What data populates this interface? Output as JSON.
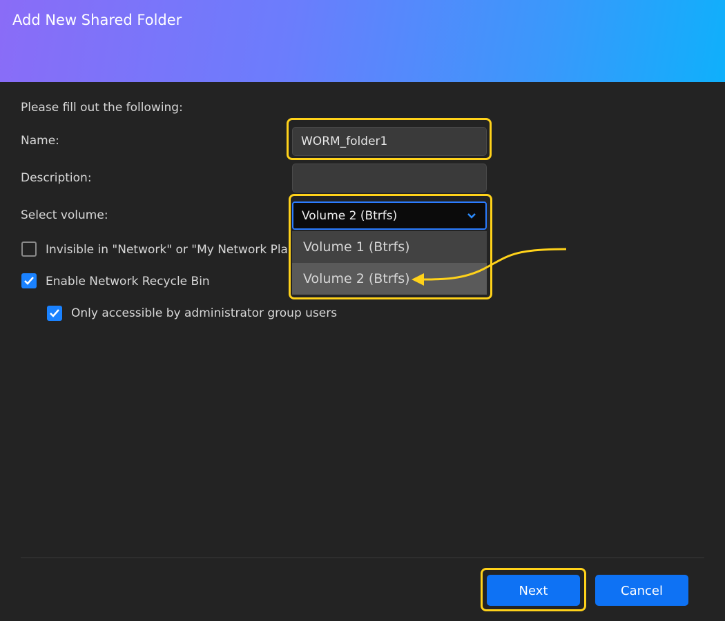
{
  "dialog": {
    "title": "Add New Shared Folder",
    "instruction": "Please fill out the following:"
  },
  "form": {
    "name_label": "Name:",
    "name_value": "WORM_folder1",
    "description_label": "Description:",
    "description_value": "",
    "volume_label": "Select volume:",
    "volume_selected": "Volume 2 (Btrfs)",
    "volume_options": [
      "Volume 1 (Btrfs)",
      "Volume 2 (Btrfs)"
    ]
  },
  "checkboxes": {
    "invisible": {
      "label": "Invisible in \"Network\" or \"My Network Pla",
      "checked": false
    },
    "recycle_bin": {
      "label": "Enable Network Recycle Bin",
      "checked": true
    },
    "admin_only": {
      "label": "Only accessible by administrator group users",
      "checked": true
    }
  },
  "buttons": {
    "next": "Next",
    "cancel": "Cancel"
  },
  "colors": {
    "accent": "#0e72f4",
    "highlight": "#ffd21a",
    "background": "#232323"
  },
  "icons": {
    "dropdown": "chevron-down-icon",
    "checkbox": "check-icon",
    "pointer": "curved-arrow-icon"
  }
}
